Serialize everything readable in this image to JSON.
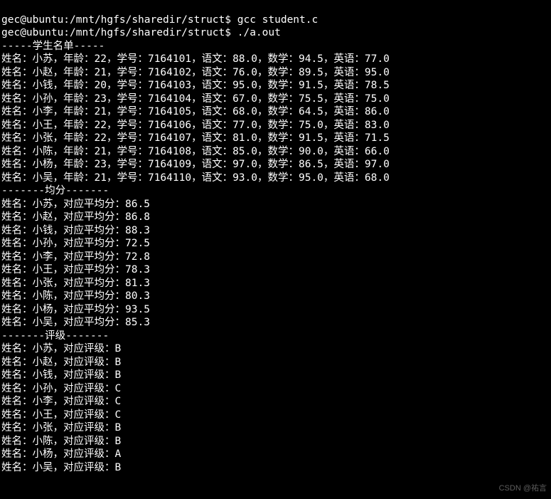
{
  "shell": {
    "prompt1": "gec@ubuntu:/mnt/hgfs/sharedir/struct$ ",
    "cmd1": "gcc student.c",
    "prompt2": "gec@ubuntu:/mnt/hgfs/sharedir/struct$ ",
    "cmd2": "./a.out"
  },
  "headers": {
    "students": "-----学生名单-----",
    "avg": "-------均分-------",
    "grade": "-------评级-------"
  },
  "labels": {
    "name": "姓名：",
    "age": "年龄：",
    "id": "学号：",
    "chinese": "语文：",
    "math": "数学：",
    "english": "英语：",
    "avg": "对应平均分：",
    "grade": "对应评级："
  },
  "sep": "，",
  "students": [
    {
      "name": "小苏",
      "age": "22",
      "id": "7164101",
      "chinese": "88.0",
      "math": "94.5",
      "english": "77.0",
      "avg": "86.5",
      "grade": "B"
    },
    {
      "name": "小赵",
      "age": "21",
      "id": "7164102",
      "chinese": "76.0",
      "math": "89.5",
      "english": "95.0",
      "avg": "86.8",
      "grade": "B"
    },
    {
      "name": "小钱",
      "age": "20",
      "id": "7164103",
      "chinese": "95.0",
      "math": "91.5",
      "english": "78.5",
      "avg": "88.3",
      "grade": "B"
    },
    {
      "name": "小孙",
      "age": "23",
      "id": "7164104",
      "chinese": "67.0",
      "math": "75.5",
      "english": "75.0",
      "avg": "72.5",
      "grade": "C"
    },
    {
      "name": "小李",
      "age": "21",
      "id": "7164105",
      "chinese": "68.0",
      "math": "64.5",
      "english": "86.0",
      "avg": "72.8",
      "grade": "C"
    },
    {
      "name": "小王",
      "age": "22",
      "id": "7164106",
      "chinese": "77.0",
      "math": "75.0",
      "english": "83.0",
      "avg": "78.3",
      "grade": "C"
    },
    {
      "name": "小张",
      "age": "22",
      "id": "7164107",
      "chinese": "81.0",
      "math": "91.5",
      "english": "71.5",
      "avg": "81.3",
      "grade": "B"
    },
    {
      "name": "小陈",
      "age": "21",
      "id": "7164108",
      "chinese": "85.0",
      "math": "90.0",
      "english": "66.0",
      "avg": "80.3",
      "grade": "B"
    },
    {
      "name": "小杨",
      "age": "23",
      "id": "7164109",
      "chinese": "97.0",
      "math": "86.5",
      "english": "97.0",
      "avg": "93.5",
      "grade": "A"
    },
    {
      "name": "小吴",
      "age": "21",
      "id": "7164110",
      "chinese": "93.0",
      "math": "95.0",
      "english": "68.0",
      "avg": "85.3",
      "grade": "B"
    }
  ],
  "watermark": "CSDN @祐言"
}
